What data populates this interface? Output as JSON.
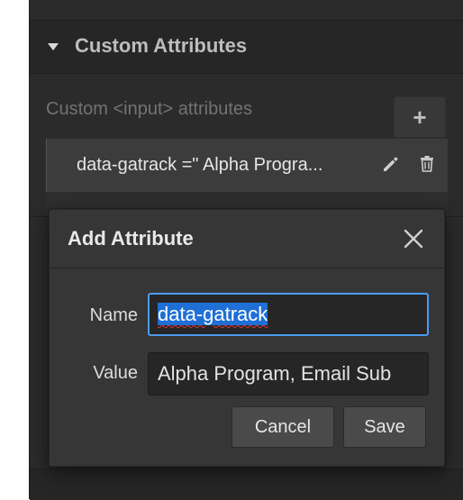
{
  "panel": {
    "section_title": "Custom Attributes",
    "attributes_description": "Custom <input> attributes",
    "add_button_label": "+",
    "attribute_row": {
      "text": "data-gatrack =\" Alpha Progra..."
    }
  },
  "dialog": {
    "title": "Add Attribute",
    "name_label": "Name",
    "name_value": "data-gatrack",
    "value_label": "Value",
    "value_value": "Alpha Program, Email Sub",
    "cancel_label": "Cancel",
    "save_label": "Save"
  },
  "colors": {
    "panel_bg": "#2b2b2b",
    "dialog_bg": "#363636",
    "focus_border": "#4a9bf0",
    "selection": "#1f6fd6"
  },
  "icons": [
    "caret-down-icon",
    "plus-icon",
    "pencil-icon",
    "trash-icon",
    "close-icon"
  ]
}
